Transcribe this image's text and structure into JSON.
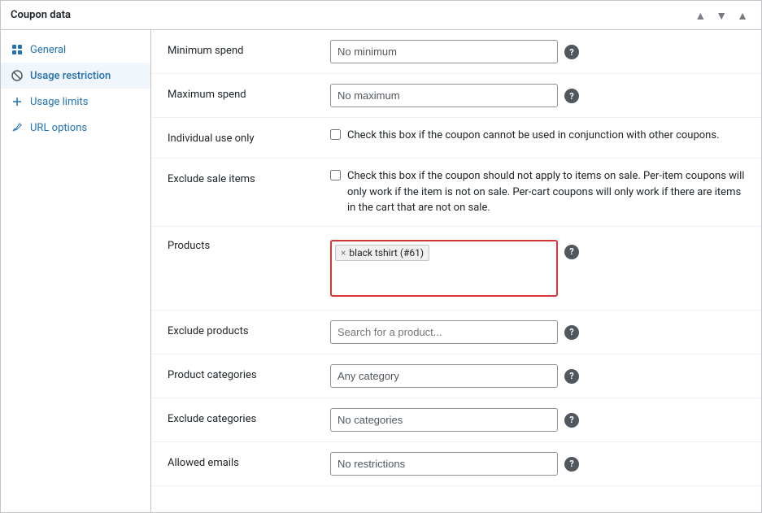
{
  "window": {
    "title": "Coupon data",
    "controls": [
      "▲",
      "▼",
      "▲"
    ]
  },
  "sidebar": {
    "items": [
      {
        "id": "general",
        "label": "General",
        "icon": "grid",
        "active": false
      },
      {
        "id": "usage-restriction",
        "label": "Usage restriction",
        "icon": "block",
        "active": true
      },
      {
        "id": "usage-limits",
        "label": "Usage limits",
        "icon": "plus",
        "active": false
      },
      {
        "id": "url-options",
        "label": "URL options",
        "icon": "wrench",
        "active": false
      }
    ]
  },
  "form": {
    "minimum_spend": {
      "label": "Minimum spend",
      "value": "No minimum",
      "help": "?"
    },
    "maximum_spend": {
      "label": "Maximum spend",
      "value": "No maximum",
      "help": "?"
    },
    "individual_use": {
      "label": "Individual use only",
      "description": "Check this box if the coupon cannot be used in conjunction with other coupons.",
      "checked": false
    },
    "exclude_sale": {
      "label": "Exclude sale items",
      "description": "Check this box if the coupon should not apply to items on sale. Per-item coupons will only work if the item is not on sale. Per-cart coupons will only work if there are items in the cart that are not on sale.",
      "checked": false
    },
    "products": {
      "label": "Products",
      "tags": [
        {
          "text": "black tshirt (#61)",
          "removable": true
        }
      ],
      "help": "?"
    },
    "exclude_products": {
      "label": "Exclude products",
      "placeholder": "Search for a product...",
      "help": "?"
    },
    "product_categories": {
      "label": "Product categories",
      "value": "Any category",
      "help": "?"
    },
    "exclude_categories": {
      "label": "Exclude categories",
      "value": "No categories",
      "help": "?"
    },
    "allowed_emails": {
      "label": "Allowed emails",
      "value": "No restrictions",
      "help": "?"
    }
  }
}
